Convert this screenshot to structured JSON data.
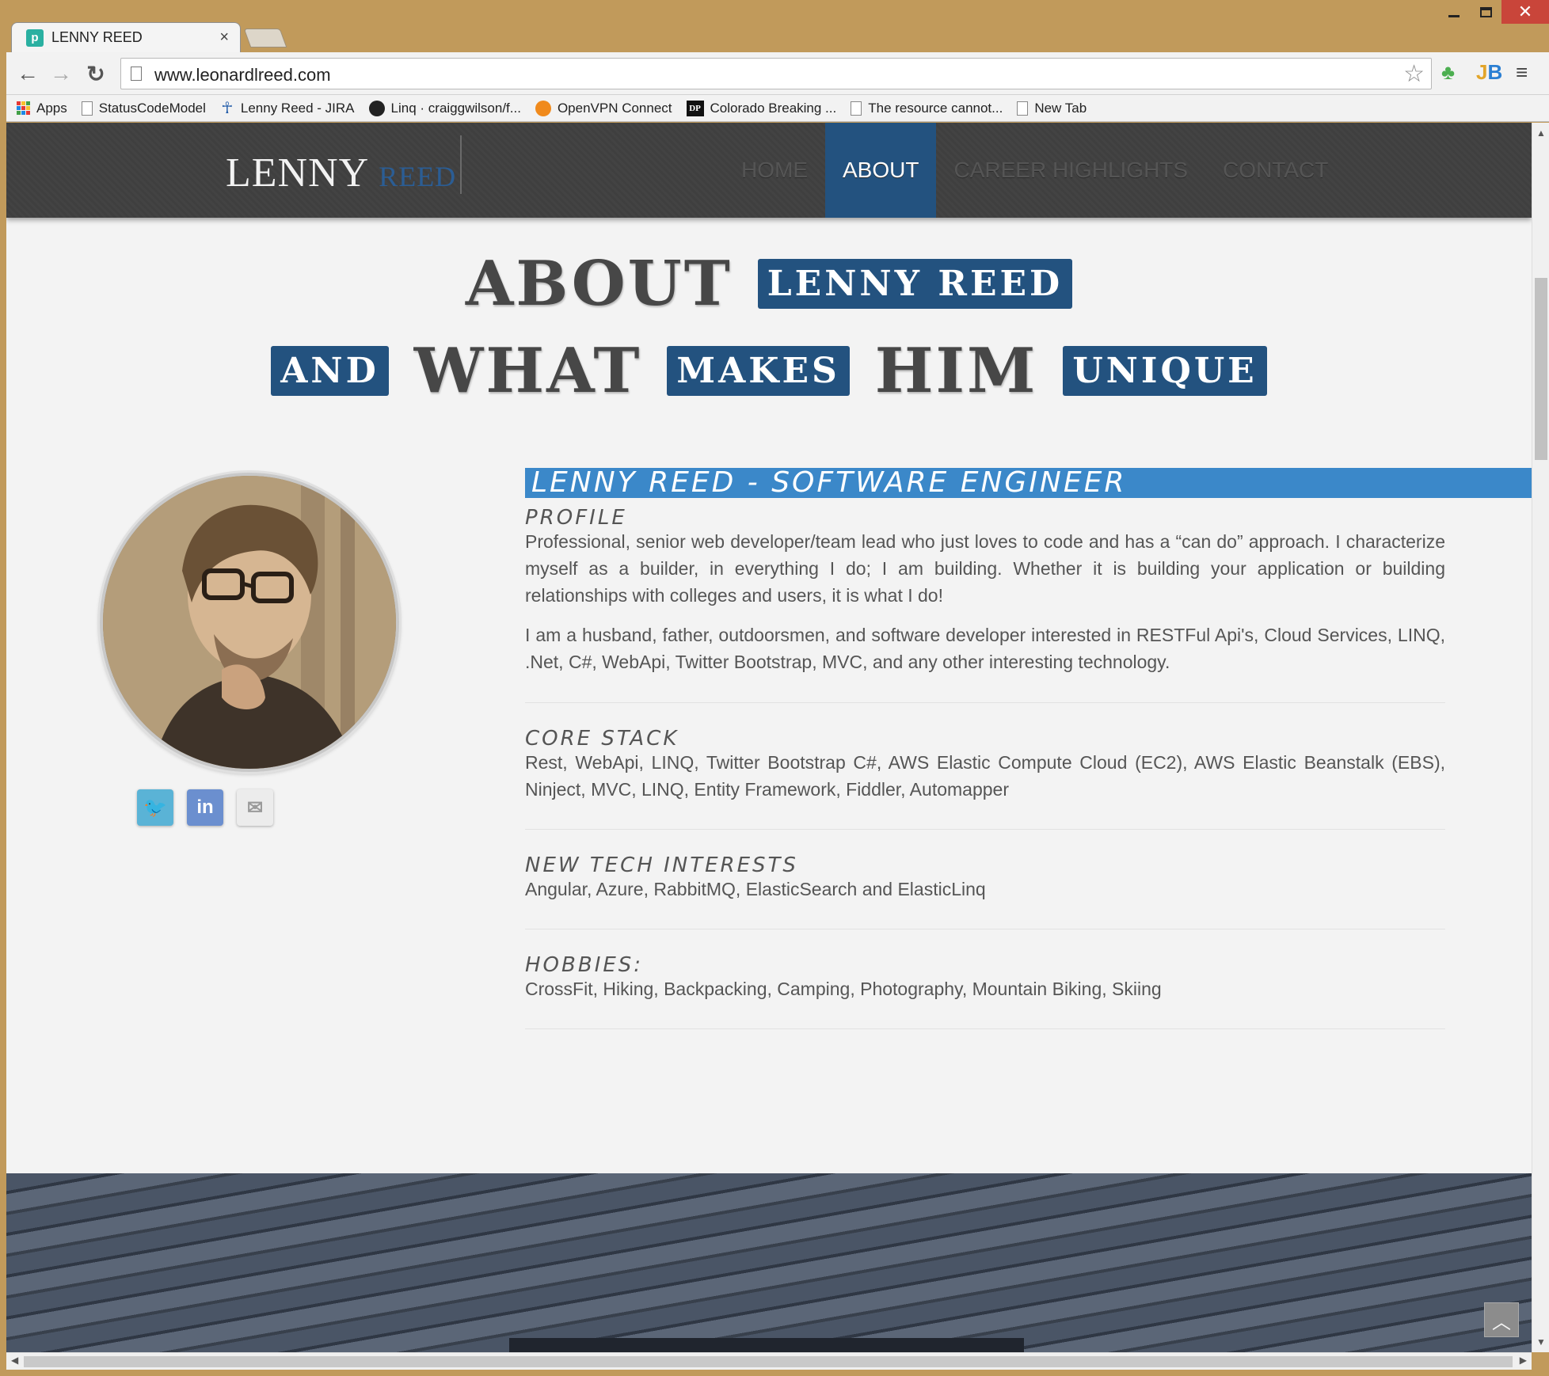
{
  "browser": {
    "tab_title": "LENNY REED",
    "tab_favicon_letter": "p",
    "url": "www.leonardlreed.com",
    "window_controls": {
      "close": "✕"
    },
    "bookmarks": [
      {
        "label": "Apps",
        "icon": "apps-grid-icon"
      },
      {
        "label": "StatusCodeModel",
        "icon": "page-icon"
      },
      {
        "label": "Lenny Reed - JIRA",
        "icon": "jira-icon"
      },
      {
        "label": "Linq · craiggwilson/f...",
        "icon": "github-icon"
      },
      {
        "label": "OpenVPN Connect",
        "icon": "openvpn-icon"
      },
      {
        "label": "Colorado Breaking ...",
        "icon": "dp-icon",
        "icon_text": "DP"
      },
      {
        "label": "The resource cannot...",
        "icon": "page-icon"
      },
      {
        "label": "New Tab",
        "icon": "page-icon"
      }
    ]
  },
  "site": {
    "brand_first": "LENNY",
    "brand_last": "REED",
    "nav": [
      {
        "label": "HOME",
        "active": false
      },
      {
        "label": "ABOUT",
        "active": true
      },
      {
        "label": "CAREER HIGHLIGHTS",
        "active": false
      },
      {
        "label": "CONTACT",
        "active": false
      }
    ],
    "accent_color": "#23527f",
    "title_line1": {
      "word": "ABOUT",
      "chip": "LENNY REED"
    },
    "title_line2": {
      "chip1": "AND",
      "word1": "WHAT",
      "chip2": "MAKES",
      "word2": "HIM",
      "chip3": "UNIQUE"
    },
    "heading": "LENNY REED - SOFTWARE ENGINEER",
    "profile_label": "PROFILE",
    "profile_p1": "Professional, senior web developer/team lead who just loves to code and has a “can do” approach. I characterize myself as a builder, in everything I do; I am building. Whether it is building your application or building relationships with colleges and users, it is what I do!",
    "profile_p2": "I am a husband, father, outdoorsmen, and software developer interested in RESTFul Api's, Cloud Services, LINQ, .Net, C#, WebApi, Twitter Bootstrap, MVC, and any other interesting technology.",
    "core_label": "CORE STACK",
    "core_text": "Rest, WebApi, LINQ, Twitter Bootstrap C#, AWS Elastic Compute Cloud (EC2), AWS Elastic Beanstalk (EBS), Ninject, MVC, LINQ, Entity Framework, Fiddler, Automapper",
    "tech_label": "NEW TECH INTERESTS",
    "tech_text": "Angular, Azure, RabbitMQ, ElasticSearch and ElasticLinq",
    "hobbies_label": "HOBBIES:",
    "hobbies_text": "CrossFit, Hiking, Backpacking, Camping, Photography, Mountain Biking, Skiing",
    "social": [
      {
        "name": "twitter-icon",
        "glyph": "🐦",
        "color": "#5ab3d6"
      },
      {
        "name": "linkedin-icon",
        "glyph": "in",
        "color": "#6b8fcf"
      },
      {
        "name": "email-icon",
        "glyph": "✉",
        "color": "#e8e8e8"
      }
    ]
  }
}
